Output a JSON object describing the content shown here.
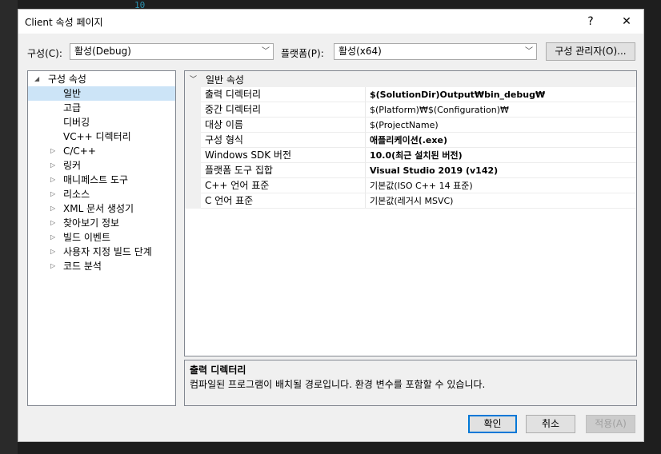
{
  "background": {
    "line_number": "10"
  },
  "dialog": {
    "title": "Client 속성 페이지",
    "help_glyph": "?",
    "close_glyph": "✕"
  },
  "toolbar": {
    "config_label": "구성(C):",
    "config_value": "활성(Debug)",
    "platform_label": "플랫폼(P):",
    "platform_value": "활성(x64)",
    "config_manager_button": "구성 관리자(O)..."
  },
  "tree": {
    "root": "구성 속성",
    "items": [
      {
        "label": "일반",
        "selected": true,
        "expandable": false
      },
      {
        "label": "고급",
        "expandable": false
      },
      {
        "label": "디버깅",
        "expandable": false
      },
      {
        "label": "VC++ 디렉터리",
        "expandable": false
      },
      {
        "label": "C/C++",
        "expandable": true
      },
      {
        "label": "링커",
        "expandable": true
      },
      {
        "label": "매니페스트 도구",
        "expandable": true
      },
      {
        "label": "리소스",
        "expandable": true
      },
      {
        "label": "XML 문서 생성기",
        "expandable": true
      },
      {
        "label": "찾아보기 정보",
        "expandable": true
      },
      {
        "label": "빌드 이벤트",
        "expandable": true
      },
      {
        "label": "사용자 지정 빌드 단계",
        "expandable": true
      },
      {
        "label": "코드 분석",
        "expandable": true
      }
    ]
  },
  "grid": {
    "section": "일반 속성",
    "rows": [
      {
        "name": "출력 디렉터리",
        "value": "$(SolutionDir)Output₩bin_debug₩",
        "bold": true
      },
      {
        "name": "중간 디렉터리",
        "value": "$(Platform)₩$(Configuration)₩",
        "bold": false
      },
      {
        "name": "대상 이름",
        "value": "$(ProjectName)",
        "bold": false
      },
      {
        "name": "구성 형식",
        "value": "애플리케이션(.exe)",
        "bold": true
      },
      {
        "name": "Windows SDK 버전",
        "value": "10.0(최근 설치된 버전)",
        "bold": true
      },
      {
        "name": "플랫폼 도구 집합",
        "value": "Visual Studio 2019 (v142)",
        "bold": true
      },
      {
        "name": "C++ 언어 표준",
        "value": "기본값(ISO C++ 14 표준)",
        "bold": false
      },
      {
        "name": "C 언어 표준",
        "value": "기본값(레거시 MSVC)",
        "bold": false
      }
    ]
  },
  "description": {
    "title": "출력 디렉터리",
    "text": "컴파일된 프로그램이 배치될 경로입니다. 환경 변수를 포함할 수 있습니다."
  },
  "footer": {
    "ok": "확인",
    "cancel": "취소",
    "apply": "적용(A)"
  },
  "colors": {
    "selection": "#cce4f7",
    "default_button_border": "#0078d7"
  }
}
